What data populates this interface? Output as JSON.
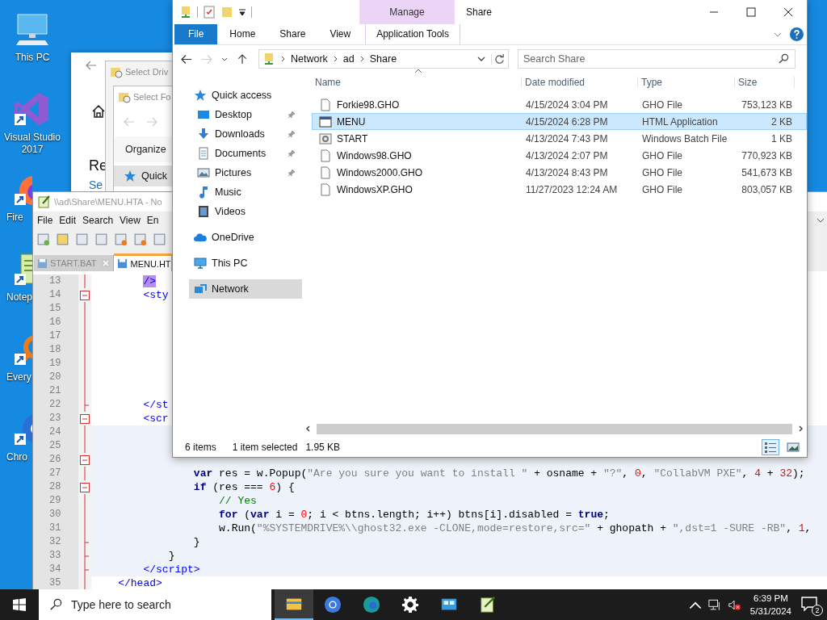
{
  "desktop_icons": [
    {
      "label": "This PC",
      "kind": "pc",
      "shortcut": false
    },
    {
      "label": "Visual Studio 2017",
      "kind": "vs",
      "shortcut": true
    },
    {
      "label": "Fire",
      "kind": "firefox",
      "shortcut": true
    },
    {
      "label": "Notep",
      "kind": "notepad",
      "shortcut": true
    },
    {
      "label": "Every",
      "kind": "everything",
      "shortcut": true
    },
    {
      "label": "Chro",
      "kind": "chrome",
      "shortcut": true
    }
  ],
  "settings_window": {
    "heading": "Re",
    "link": "Se"
  },
  "select_drive_dialog": {
    "title": "Select Driv"
  },
  "select_folder_dialog": {
    "title": "Select Fo",
    "organize": "Organize",
    "nav_item": "Quick"
  },
  "notepad": {
    "title": "\\\\ad\\Share\\MENU.HTA - No",
    "menu": [
      "File",
      "Edit",
      "Search",
      "View",
      "En"
    ],
    "tabs": [
      {
        "label": "START.BAT",
        "selected": false
      },
      {
        "label": "MENU.HT",
        "selected": true
      }
    ],
    "lines": [
      {
        "number": "13",
        "fold_start": false,
        "fold_end": false,
        "highlight": false,
        "segments": [
          {
            "kind": "tagmatch",
            "text": "        />"
          }
        ]
      },
      {
        "number": "14",
        "fold_start": true,
        "fold_end": false,
        "highlight": false,
        "segments": [
          {
            "kind": "tag",
            "text": "        <sty"
          }
        ]
      },
      {
        "number": "15",
        "fold_start": false,
        "fold_end": false,
        "highlight": false
      },
      {
        "number": "16",
        "fold_start": false,
        "fold_end": false,
        "highlight": false
      },
      {
        "number": "17",
        "fold_start": false,
        "fold_end": false,
        "highlight": false
      },
      {
        "number": "18",
        "fold_start": false,
        "fold_end": false,
        "highlight": false
      },
      {
        "number": "19",
        "fold_start": false,
        "fold_end": false,
        "highlight": false
      },
      {
        "number": "20",
        "fold_start": false,
        "fold_end": false,
        "highlight": false
      },
      {
        "number": "21",
        "fold_start": false,
        "fold_end": false,
        "highlight": false
      },
      {
        "number": "22",
        "fold_start": false,
        "fold_end": true,
        "highlight": false,
        "segments": [
          {
            "kind": "tag",
            "text": "        </st"
          }
        ]
      },
      {
        "number": "23",
        "fold_start": true,
        "fold_end": false,
        "highlight": false,
        "segments": [
          {
            "kind": "tag",
            "text": "        <scr"
          }
        ]
      },
      {
        "number": "24",
        "fold_start": false,
        "fold_end": false,
        "highlight": true
      },
      {
        "number": "25",
        "fold_start": false,
        "fold_end": false,
        "highlight": true
      },
      {
        "number": "26",
        "fold_start": true,
        "fold_end": false,
        "highlight": true
      },
      {
        "number": "27",
        "fold_start": false,
        "fold_end": false,
        "highlight": true,
        "segments": [
          {
            "kind": "keyword",
            "text": "                var"
          },
          {
            "kind": "plain",
            "text": " res = w.Popup("
          },
          {
            "kind": "string",
            "text": "\"Are you sure you want to install \""
          },
          {
            "kind": "plain",
            "text": " + osname + "
          },
          {
            "kind": "string",
            "text": "\"?\""
          },
          {
            "kind": "plain",
            "text": ", "
          },
          {
            "kind": "number",
            "text": "0"
          },
          {
            "kind": "plain",
            "text": ", "
          },
          {
            "kind": "string",
            "text": "\"CollabVM PXE\""
          },
          {
            "kind": "plain",
            "text": ", "
          },
          {
            "kind": "number",
            "text": "4"
          },
          {
            "kind": "plain",
            "text": " + "
          },
          {
            "kind": "number",
            "text": "32"
          },
          {
            "kind": "plain",
            "text": ");"
          }
        ]
      },
      {
        "number": "28",
        "fold_start": true,
        "fold_end": false,
        "highlight": true,
        "segments": [
          {
            "kind": "keyword",
            "text": "                if"
          },
          {
            "kind": "plain",
            "text": " (res === "
          },
          {
            "kind": "number",
            "text": "6"
          },
          {
            "kind": "plain",
            "text": ") {"
          }
        ]
      },
      {
        "number": "29",
        "fold_start": false,
        "fold_end": false,
        "highlight": true,
        "segments": [
          {
            "kind": "comment",
            "text": "                    // Yes"
          }
        ]
      },
      {
        "number": "30",
        "fold_start": false,
        "fold_end": false,
        "highlight": true,
        "segments": [
          {
            "kind": "keyword",
            "text": "                    for"
          },
          {
            "kind": "plain",
            "text": " ("
          },
          {
            "kind": "keyword",
            "text": "var"
          },
          {
            "kind": "plain",
            "text": " i = "
          },
          {
            "kind": "number",
            "text": "0"
          },
          {
            "kind": "plain",
            "text": "; i < btns.length; i++) btns[i].disabled = "
          },
          {
            "kind": "keyword",
            "text": "true"
          },
          {
            "kind": "plain",
            "text": ";"
          }
        ]
      },
      {
        "number": "31",
        "fold_start": false,
        "fold_end": false,
        "highlight": true,
        "segments": [
          {
            "kind": "plain",
            "text": "                    w.Run("
          },
          {
            "kind": "string",
            "text": "\"%SYSTEMDRIVE%\\\\ghost32.exe -CLONE,mode=restore,src=\""
          },
          {
            "kind": "plain",
            "text": " + ghopath + "
          },
          {
            "kind": "string",
            "text": "\",dst=1 -SURE -RB\""
          },
          {
            "kind": "plain",
            "text": ", "
          },
          {
            "kind": "number",
            "text": "1"
          },
          {
            "kind": "plain",
            "text": ","
          }
        ]
      },
      {
        "number": "32",
        "fold_start": false,
        "fold_end": true,
        "highlight": true,
        "segments": [
          {
            "kind": "plain",
            "text": "                }"
          }
        ]
      },
      {
        "number": "33",
        "fold_start": false,
        "fold_end": true,
        "highlight": true,
        "segments": [
          {
            "kind": "plain",
            "text": "            }"
          }
        ]
      },
      {
        "number": "34",
        "fold_start": false,
        "fold_end": true,
        "highlight": true,
        "segments": [
          {
            "kind": "tag",
            "text": "        </script>"
          }
        ]
      },
      {
        "number": "35",
        "fold_start": false,
        "fold_end": false,
        "highlight": false,
        "segments": [
          {
            "kind": "tag",
            "text": "    </head>"
          }
        ]
      }
    ]
  },
  "explorer": {
    "title": "Share",
    "context_header": "Manage",
    "ribbon_tabs": [
      {
        "label": "File",
        "kind": "file"
      },
      {
        "label": "Home",
        "kind": "plain"
      },
      {
        "label": "Share",
        "kind": "plain"
      },
      {
        "label": "View",
        "kind": "plain"
      },
      {
        "label": "Application Tools",
        "kind": "contextual"
      }
    ],
    "breadcrumbs": [
      "Network",
      "ad",
      "Share"
    ],
    "search": {
      "placeholder": "Search Share"
    },
    "nav": [
      {
        "label": "Quick access",
        "kind": "star",
        "selected": false,
        "children": [
          {
            "label": "Desktop",
            "kind": "desktop",
            "pinned": true,
            "selected": false
          },
          {
            "label": "Downloads",
            "kind": "download",
            "pinned": true,
            "selected": false
          },
          {
            "label": "Documents",
            "kind": "document",
            "pinned": true,
            "selected": false
          },
          {
            "label": "Pictures",
            "kind": "pictures",
            "pinned": true,
            "selected": false
          },
          {
            "label": "Music",
            "kind": "music",
            "pinned": false,
            "selected": false
          },
          {
            "label": "Videos",
            "kind": "videos",
            "pinned": false,
            "selected": false
          }
        ]
      },
      {
        "label": "OneDrive",
        "kind": "cloud",
        "selected": false
      },
      {
        "label": "This PC",
        "kind": "pc",
        "selected": false
      },
      {
        "label": "Network",
        "kind": "network",
        "selected": true
      }
    ],
    "columns": [
      "Name",
      "Date modified",
      "Type",
      "Size"
    ],
    "files": [
      {
        "name": "Forkie98.GHO",
        "date": "4/15/2024 3:04 PM",
        "type": "GHO File",
        "size": "753,123 KB",
        "kind": "file",
        "selected": false
      },
      {
        "name": "MENU",
        "date": "4/15/2024 6:28 PM",
        "type": "HTML Application",
        "size": "2 KB",
        "kind": "app",
        "selected": true
      },
      {
        "name": "START",
        "date": "4/13/2024 7:43 PM",
        "type": "Windows Batch File",
        "size": "1 KB",
        "kind": "batch",
        "selected": false
      },
      {
        "name": "Windows98.GHO",
        "date": "4/13/2024 2:07 PM",
        "type": "GHO File",
        "size": "770,923 KB",
        "kind": "file",
        "selected": false
      },
      {
        "name": "Windows2000.GHO",
        "date": "4/13/2024 8:43 PM",
        "type": "GHO File",
        "size": "541,673 KB",
        "kind": "file",
        "selected": false
      },
      {
        "name": "WindowsXP.GHO",
        "date": "11/27/2023 12:24 AM",
        "type": "GHO File",
        "size": "803,057 KB",
        "kind": "file",
        "selected": false
      }
    ],
    "status": {
      "count": "6 items",
      "selection": "1 item selected",
      "size": "1.95 KB"
    },
    "views": [
      {
        "kind": "details",
        "selected": true
      },
      {
        "kind": "large",
        "selected": false
      }
    ]
  },
  "taskbar": {
    "search_placeholder": "Type here to search",
    "apps": [
      {
        "kind": "explorer",
        "active": true
      },
      {
        "kind": "chrome",
        "active": false
      },
      {
        "kind": "edge",
        "active": false
      },
      {
        "kind": "settings",
        "active": false
      },
      {
        "kind": "remote",
        "active": false
      },
      {
        "kind": "notepad",
        "active": false
      }
    ],
    "time": "6:39 PM",
    "date": "5/31/2024",
    "notifications": "2"
  }
}
